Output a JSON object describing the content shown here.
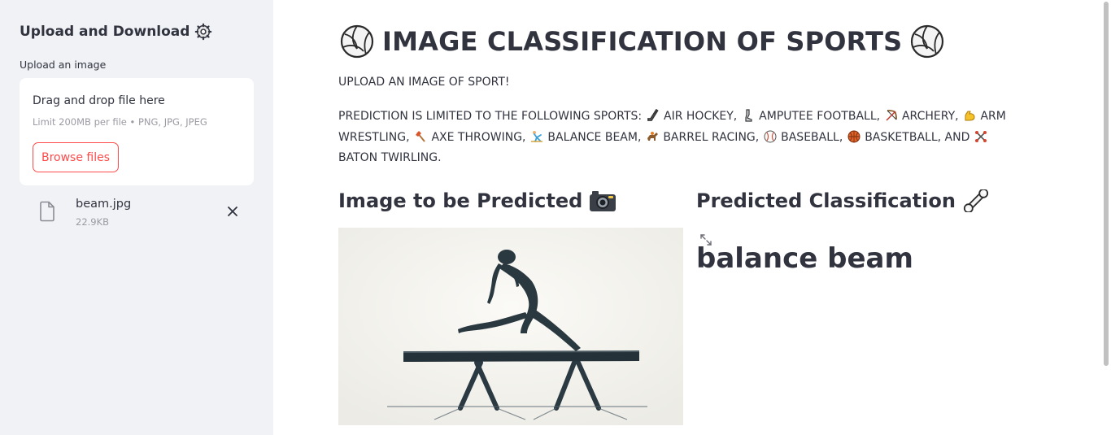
{
  "sidebar": {
    "title": "Upload and Download",
    "title_icon": "gear-icon",
    "upload_label": "Upload an image",
    "dropzone": {
      "title": "Drag and drop file here",
      "limit": "Limit 200MB per file • PNG, JPG, JPEG",
      "browse_label": "Browse files"
    },
    "file": {
      "name": "beam.jpg",
      "size": "22.9KB",
      "icon": "file-icon"
    }
  },
  "main": {
    "title": "IMAGE CLASSIFICATION OF SPORTS",
    "title_icons": [
      "volleyball-icon",
      "volleyball-icon"
    ],
    "upload_prompt": "UPLOAD AN IMAGE OF SPORT!",
    "prediction_intro": "PREDICTION IS LIMITED TO THE FOLLOWING SPORTS:",
    "sports": [
      {
        "label": "AIR HOCKEY,",
        "icon": "hockey-stick-icon"
      },
      {
        "label": "AMPUTEE FOOTBALL,",
        "icon": "prosthetic-leg-icon"
      },
      {
        "label": "ARCHERY,",
        "icon": "bow-and-arrow-icon"
      },
      {
        "label": "ARM WRESTLING,",
        "icon": "flexed-bicep-icon"
      },
      {
        "label": "AXE THROWING,",
        "icon": "axe-icon"
      },
      {
        "label": "BALANCE BEAM,",
        "icon": "gymnast-icon"
      },
      {
        "label": "BARREL RACING,",
        "icon": "horse-racing-icon"
      },
      {
        "label": "BASEBALL,",
        "icon": "baseball-icon"
      },
      {
        "label": "BASKETBALL, AND",
        "icon": "basketball-icon"
      },
      {
        "label": "BATON TWIRLING.",
        "icon": "batons-icon"
      }
    ],
    "left_heading": "Image to be Predicted",
    "left_heading_icon": "camera-icon",
    "right_heading": "Predicted Classification",
    "right_heading_icon": "wrench-icon",
    "result": "balance beam"
  },
  "colors": {
    "sidebar_bg": "#f0f2f6",
    "accent": "#ff4b4b",
    "text": "#31333f",
    "muted": "#9a9ba3"
  }
}
